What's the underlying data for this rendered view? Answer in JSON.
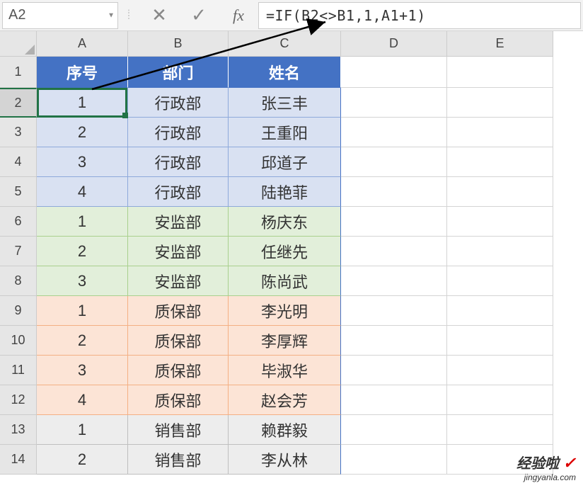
{
  "nameBox": "A2",
  "formula": "=IF(B2<>B1,1,A1+1)",
  "colHeaders": [
    "A",
    "B",
    "C",
    "D",
    "E"
  ],
  "rowHeaders": [
    "1",
    "2",
    "3",
    "4",
    "5",
    "6",
    "7",
    "8",
    "9",
    "10",
    "11",
    "12",
    "13",
    "14"
  ],
  "header": {
    "a": "序号",
    "b": "部门",
    "c": "姓名"
  },
  "rows": [
    {
      "a": "1",
      "b": "行政部",
      "c": "张三丰",
      "group": "blue"
    },
    {
      "a": "2",
      "b": "行政部",
      "c": "王重阳",
      "group": "blue"
    },
    {
      "a": "3",
      "b": "行政部",
      "c": "邱道子",
      "group": "blue"
    },
    {
      "a": "4",
      "b": "行政部",
      "c": "陆艳菲",
      "group": "blue"
    },
    {
      "a": "1",
      "b": "安监部",
      "c": "杨庆东",
      "group": "green"
    },
    {
      "a": "2",
      "b": "安监部",
      "c": "任继先",
      "group": "green"
    },
    {
      "a": "3",
      "b": "安监部",
      "c": "陈尚武",
      "group": "green"
    },
    {
      "a": "1",
      "b": "质保部",
      "c": "李光明",
      "group": "orange"
    },
    {
      "a": "2",
      "b": "质保部",
      "c": "李厚辉",
      "group": "orange"
    },
    {
      "a": "3",
      "b": "质保部",
      "c": "毕淑华",
      "group": "orange"
    },
    {
      "a": "4",
      "b": "质保部",
      "c": "赵会芳",
      "group": "orange"
    },
    {
      "a": "1",
      "b": "销售部",
      "c": "赖群毅",
      "group": "gray"
    },
    {
      "a": "2",
      "b": "销售部",
      "c": "李从林",
      "group": "gray"
    }
  ],
  "watermark": {
    "main": "经验啦",
    "sub": "jingyanla.com"
  },
  "icons": {
    "dropdown": "▼",
    "dots": "⁞",
    "cancel": "✕",
    "confirm": "✓",
    "fx": "fx",
    "check": "✓"
  }
}
